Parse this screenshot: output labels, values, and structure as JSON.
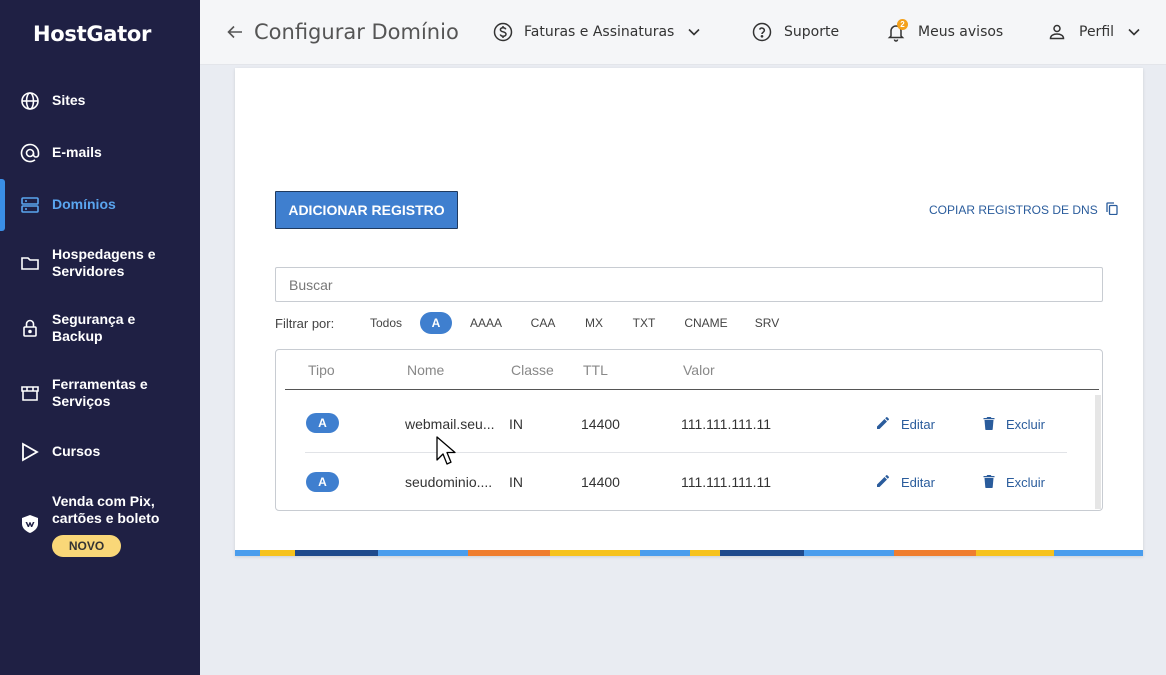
{
  "sidebar": {
    "logo": "HostGator",
    "items": [
      {
        "label": "Sites",
        "icon": "globe-icon"
      },
      {
        "label": "E-mails",
        "icon": "at-icon"
      },
      {
        "label": "Domínios",
        "icon": "server-icon",
        "active": true
      },
      {
        "label": "Hospedagens e Servidores",
        "icon": "folder-icon"
      },
      {
        "label": "Segurança e Backup",
        "icon": "lock-icon"
      },
      {
        "label": "Ferramentas e Serviços",
        "icon": "store-icon"
      },
      {
        "label": "Cursos",
        "icon": "play-icon"
      },
      {
        "label": "Venda com Pix, cartões e boleto",
        "icon": "shield-icon"
      }
    ],
    "novo_badge": "NOVO"
  },
  "header": {
    "title": "Configurar Domínio",
    "invoices": "Faturas e Assinaturas",
    "support": "Suporte",
    "notices": "Meus avisos",
    "notices_count": "2",
    "profile": "Perfil"
  },
  "main": {
    "add_button": "ADICIONAR REGISTRO",
    "copy_link": "COPIAR REGISTROS DE DNS",
    "search_placeholder": "Buscar",
    "filter_label": "Filtrar por:",
    "filters": [
      "Todos",
      "A",
      "AAAA",
      "CAA",
      "MX",
      "TXT",
      "CNAME",
      "SRV"
    ],
    "active_filter": "A",
    "table": {
      "headers": [
        "Tipo",
        "Nome",
        "Classe",
        "TTL",
        "Valor"
      ],
      "rows": [
        {
          "type": "A",
          "name": "webmail.seu...",
          "class": "IN",
          "ttl": "14400",
          "value": "111.111.111.11",
          "edit": "Editar",
          "delete": "Excluir"
        },
        {
          "type": "A",
          "name": "seudominio....",
          "class": "IN",
          "ttl": "14400",
          "value": "111.111.111.11",
          "edit": "Editar",
          "delete": "Excluir"
        }
      ]
    }
  },
  "colors": {
    "sidebar_bg": "#1f2044",
    "accent": "#3f7fcf",
    "active_nav": "#5aa5ef",
    "badge_yellow": "#f9d778",
    "notif_orange": "#f4a11b"
  }
}
